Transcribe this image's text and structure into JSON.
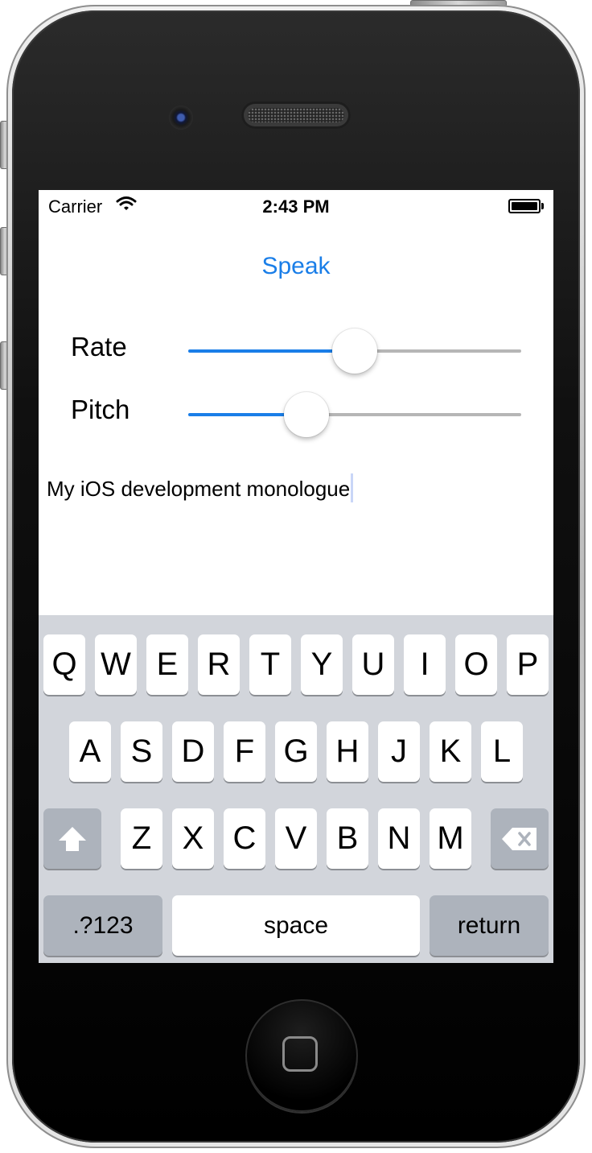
{
  "status_bar": {
    "carrier": "Carrier",
    "time": "2:43 PM",
    "wifi_icon": "wifi-icon",
    "battery_icon": "battery-icon",
    "battery_level": 1.0
  },
  "main": {
    "speak_button": "Speak",
    "rate": {
      "label": "Rate",
      "value": 0.5
    },
    "pitch": {
      "label": "Pitch",
      "value": 0.355
    },
    "text": "My iOS development monologue"
  },
  "keyboard": {
    "row1": [
      "Q",
      "W",
      "E",
      "R",
      "T",
      "Y",
      "U",
      "I",
      "O",
      "P"
    ],
    "row2": [
      "A",
      "S",
      "D",
      "F",
      "G",
      "H",
      "J",
      "K",
      "L"
    ],
    "row3": [
      "Z",
      "X",
      "C",
      "V",
      "B",
      "N",
      "M"
    ],
    "shift_icon": "shift-arrow-icon",
    "delete_icon": "backspace-icon",
    "numbers_label": ".?123",
    "space_label": "space",
    "return_label": "return"
  },
  "colors": {
    "accent": "#1a7ee8",
    "track": "#b6b6b6",
    "keyboard_bg": "#d2d5db",
    "key_gray": "#adb3bc"
  }
}
